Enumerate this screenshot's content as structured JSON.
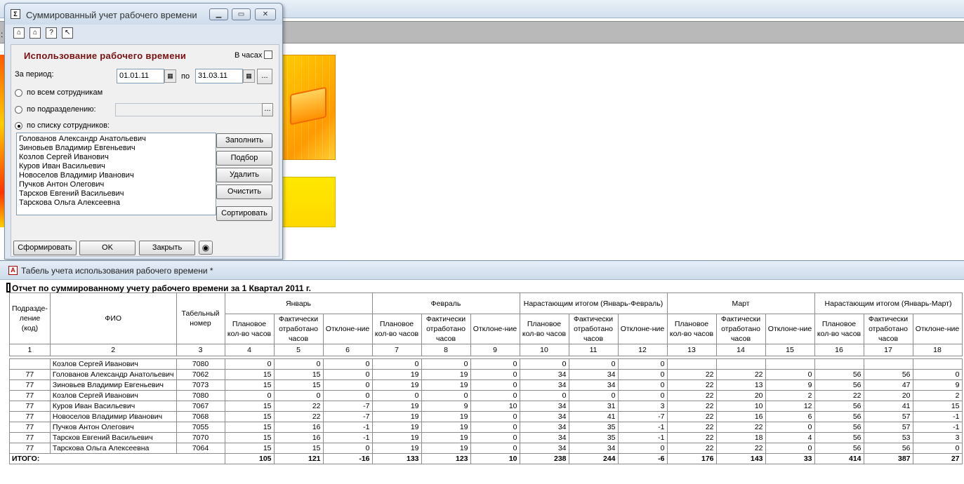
{
  "dialog": {
    "title": "Суммированный учет рабочего времени",
    "heading": "Использование рабочего времени",
    "hours_label": "В часах",
    "period_label": "За период:",
    "date_from": "01.01.11",
    "to_label": "по",
    "date_to": "31.03.11",
    "dots": "...",
    "radio_all": "по всем сотрудникам",
    "radio_division": "по подразделению:",
    "radio_list": "по списку сотрудников:",
    "employees": [
      "Голованов Александр Анатольевич",
      "Зиновьев Владимир Евгеньевич",
      "Козлов Сергей Иванович",
      "Куров Иван Васильевич",
      "Новоселов Владимир Иванович",
      "Пучков Антон Олегович",
      "Тарсков Евгений Васильевич",
      "Тарскова Ольга Алексеевна"
    ],
    "btn_fill": "Заполнить",
    "btn_select": "Подбор",
    "btn_delete": "Удалить",
    "btn_clear": "Очистить",
    "btn_sort": "Сортировать",
    "btn_generate": "Сформировать",
    "btn_ok": "OK",
    "btn_close": "Закрыть"
  },
  "report": {
    "title": "Табель учета использования рабочего времени  *",
    "caption": "Отчет по суммированному учету рабочего времени за 1 Квартал 2011 г.",
    "headers": {
      "division": "Подразде-ление (код)",
      "fio": "ФИО",
      "tab_no": "Табельный номер",
      "groups": [
        "Январь",
        "Февраль",
        "Нарастающим итогом (Январь-Февраль)",
        "Март",
        "Нарастающим итогом (Январь-Март)"
      ],
      "sub": [
        "Плановое кол-во часов",
        "Фактически отработано часов",
        "Отклоне-ние"
      ],
      "col_numbers": [
        "1",
        "2",
        "3",
        "4",
        "5",
        "6",
        "7",
        "8",
        "9",
        "10",
        "11",
        "12",
        "13",
        "14",
        "15",
        "16",
        "17",
        "18"
      ]
    },
    "rows": [
      {
        "div": "",
        "fio": "Козлов Сергей Иванович",
        "tab": "7080",
        "v": [
          "0",
          "0",
          "0",
          "0",
          "0",
          "0",
          "0",
          "0",
          "0",
          "",
          "",
          "",
          "",
          "",
          ""
        ]
      },
      {
        "div": "77",
        "fio": "Голованов Александр Анатольевич",
        "tab": "7062",
        "v": [
          "15",
          "15",
          "0",
          "19",
          "19",
          "0",
          "34",
          "34",
          "0",
          "22",
          "22",
          "0",
          "56",
          "56",
          "0"
        ]
      },
      {
        "div": "77",
        "fio": "Зиновьев Владимир Евгеньевич",
        "tab": "7073",
        "v": [
          "15",
          "15",
          "0",
          "19",
          "19",
          "0",
          "34",
          "34",
          "0",
          "22",
          "13",
          "9",
          "56",
          "47",
          "9"
        ]
      },
      {
        "div": "77",
        "fio": "Козлов Сергей Иванович",
        "tab": "7080",
        "v": [
          "0",
          "0",
          "0",
          "0",
          "0",
          "0",
          "0",
          "0",
          "0",
          "22",
          "20",
          "2",
          "22",
          "20",
          "2"
        ]
      },
      {
        "div": "77",
        "fio": "Куров Иван Васильевич",
        "tab": "7067",
        "v": [
          "15",
          "22",
          "-7",
          "19",
          "9",
          "10",
          "34",
          "31",
          "3",
          "22",
          "10",
          "12",
          "56",
          "41",
          "15"
        ]
      },
      {
        "div": "77",
        "fio": "Новоселов Владимир Иванович",
        "tab": "7068",
        "v": [
          "15",
          "22",
          "-7",
          "19",
          "19",
          "0",
          "34",
          "41",
          "-7",
          "22",
          "16",
          "6",
          "56",
          "57",
          "-1"
        ]
      },
      {
        "div": "77",
        "fio": "Пучков Антон Олегович",
        "tab": "7055",
        "v": [
          "15",
          "16",
          "-1",
          "19",
          "19",
          "0",
          "34",
          "35",
          "-1",
          "22",
          "22",
          "0",
          "56",
          "57",
          "-1"
        ]
      },
      {
        "div": "77",
        "fio": "Тарсков Евгений Васильевич",
        "tab": "7070",
        "v": [
          "15",
          "16",
          "-1",
          "19",
          "19",
          "0",
          "34",
          "35",
          "-1",
          "22",
          "18",
          "4",
          "56",
          "53",
          "3"
        ]
      },
      {
        "div": "77",
        "fio": "Тарскова Ольга Алексеевна",
        "tab": "7064",
        "v": [
          "15",
          "15",
          "0",
          "19",
          "19",
          "0",
          "34",
          "34",
          "0",
          "22",
          "22",
          "0",
          "56",
          "56",
          "0"
        ]
      }
    ],
    "total_label": "ИТОГО:",
    "totals": [
      "105",
      "121",
      "-16",
      "133",
      "123",
      "10",
      "238",
      "244",
      "-6",
      "176",
      "143",
      "33",
      "414",
      "387",
      "27"
    ]
  }
}
